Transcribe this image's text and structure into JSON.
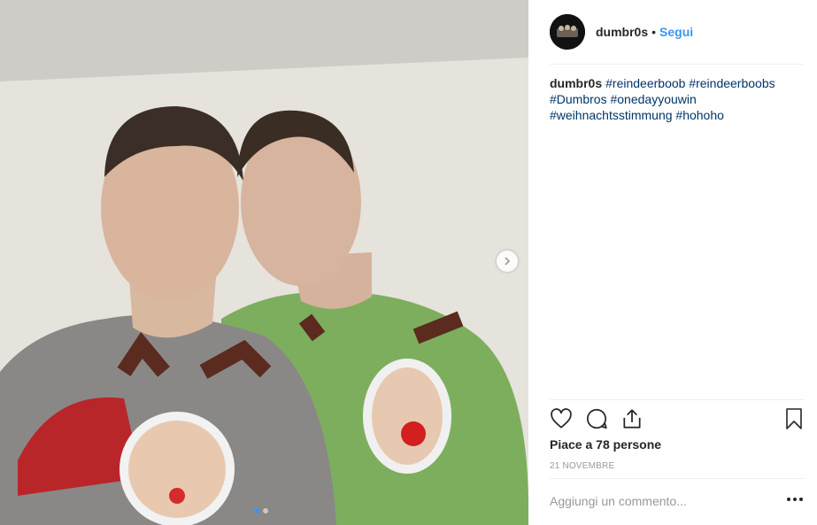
{
  "post": {
    "username": "dumbr0s",
    "separator": "•",
    "follow_label": "Segui"
  },
  "caption": {
    "username": "dumbr0s",
    "hashtags": [
      "#reindeerboob",
      "#reindeerboobs",
      "#Dumbros",
      "#onedayyouwin",
      "#weihnachtsstimmung",
      "#hohoho"
    ]
  },
  "actions": {
    "icons": [
      "heart-icon",
      "comment-icon",
      "share-icon",
      "bookmark-icon"
    ]
  },
  "likes_text": "Piace a 78 persone",
  "date_text": "21 NOVEMBRE",
  "comment": {
    "placeholder": "Aggiungi un commento..."
  },
  "carousel": {
    "current": 1,
    "total": 2
  },
  "colors": {
    "link": "#003569",
    "accent": "#3897f0",
    "text": "#262626"
  }
}
